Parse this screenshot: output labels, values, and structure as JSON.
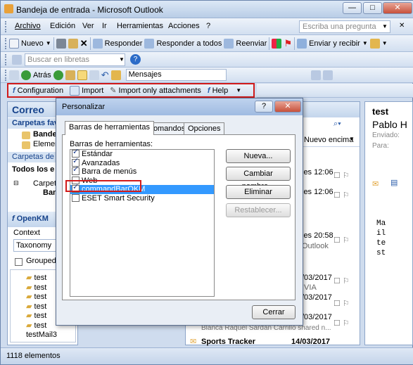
{
  "window": {
    "title": "Bandeja de entrada - Microsoft Outlook",
    "min": "—",
    "max": "□",
    "close": "✕"
  },
  "menu": {
    "items": [
      "Archivo",
      "Edición",
      "Ver",
      "Ir",
      "Herramientas",
      "Acciones",
      "?"
    ],
    "ask": "Escriba una pregunta"
  },
  "toolbar1": {
    "new": "Nuevo",
    "reply": "Responder",
    "reply_all": "Responder a todos",
    "forward": "Reenviar",
    "send_receive": "Enviar y recibir"
  },
  "toolbar2": {
    "search_placeholder": "Buscar en libretas"
  },
  "toolbar3": {
    "back": "Atrás",
    "folder_combo": "Mensajes"
  },
  "okm_bar": {
    "configuration": "Configuration",
    "import": "Import",
    "import_attach": "Import only attachments",
    "help": "Help"
  },
  "nav": {
    "header": "Correo",
    "favorites": "Carpetas favori",
    "fav1": "Bandej",
    "fav2": "Element",
    "folders": "Carpetas de co",
    "all": "Todos los e",
    "carpeta": "Carpeta",
    "bandeja": "Band",
    "okm": "OpenKM",
    "context_label": "Context",
    "context_value": "Taxonomy",
    "grouped": "Grouped",
    "tree": [
      "test",
      "test",
      "test",
      "test",
      "test",
      "test",
      "testMail3"
    ]
  },
  "status": {
    "count": "1118 elementos"
  },
  "list": {
    "header": "Bandeja de ent",
    "sort": "Nuevo encima",
    "times": [
      "les 12:06",
      "les 12:06",
      "les 20:58",
      "/03/2017",
      "/03/2017",
      "/03/2017"
    ],
    "outlook": "Outlook",
    "ivia": "IVIA",
    "snippet": "Blanca Raquel Sardan Carrillo shared n...",
    "last_sender": "Sports Tracker",
    "last_date": "14/03/2017"
  },
  "reading": {
    "subject": "test",
    "from": "Pablo H",
    "sent_label": "Enviado:",
    "to_label": "Para:",
    "body": [
      "Ma",
      "il",
      "te",
      "st"
    ]
  },
  "dialog": {
    "title": "Personalizar",
    "help": "?",
    "close": "✕",
    "tabs": [
      "Barras de herramientas",
      "Comandos",
      "Opciones"
    ],
    "group_label": "Barras de herramientas:",
    "items": [
      {
        "label": "Estándar",
        "checked": true
      },
      {
        "label": "Avanzadas",
        "checked": true
      },
      {
        "label": "Barra de menús",
        "checked": true
      },
      {
        "label": "Web",
        "checked": false
      },
      {
        "label": "commandBarOKM",
        "checked": true
      },
      {
        "label": "ESET Smart Security",
        "checked": false
      }
    ],
    "buttons": {
      "new": "Nueva...",
      "rename": "Cambiar nombre...",
      "delete": "Eliminar",
      "reset": "Restablecer...",
      "close": "Cerrar"
    }
  }
}
